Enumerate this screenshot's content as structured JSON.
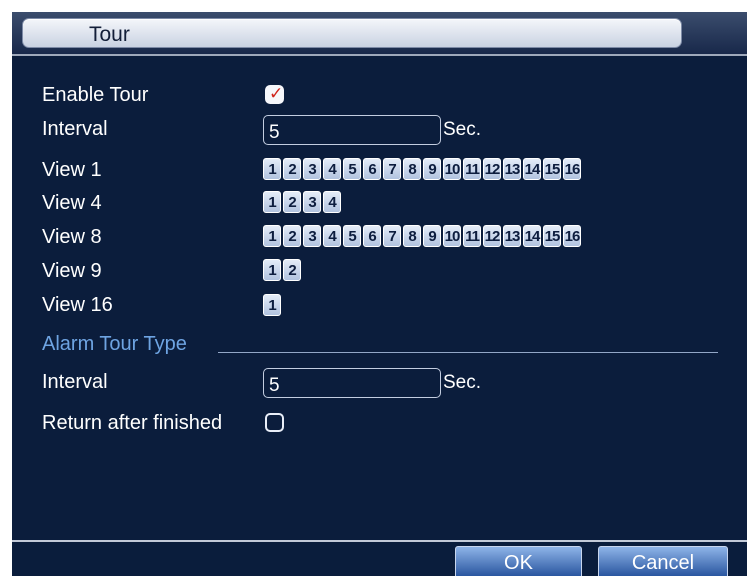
{
  "window": {
    "title": "Tour"
  },
  "tour": {
    "enable_label": "Enable Tour",
    "enable_checked": true,
    "interval_label": "Interval",
    "interval_value": "5",
    "interval_unit": "Sec.",
    "views": [
      {
        "label": "View 1",
        "channels": [
          "1",
          "2",
          "3",
          "4",
          "5",
          "6",
          "7",
          "8",
          "9",
          "10",
          "11",
          "12",
          "13",
          "14",
          "15",
          "16"
        ]
      },
      {
        "label": "View 4",
        "channels": [
          "1",
          "2",
          "3",
          "4"
        ]
      },
      {
        "label": "View 8",
        "channels": [
          "1",
          "2",
          "3",
          "4",
          "5",
          "6",
          "7",
          "8",
          "9",
          "10",
          "11",
          "12",
          "13",
          "14",
          "15",
          "16"
        ]
      },
      {
        "label": "View 9",
        "channels": [
          "1",
          "2"
        ]
      },
      {
        "label": "View 16",
        "channels": [
          "1"
        ]
      }
    ]
  },
  "alarm": {
    "section_label": "Alarm Tour Type",
    "interval_label": "Interval",
    "interval_value": "5",
    "interval_unit": "Sec.",
    "return_label": "Return after finished",
    "return_checked": false
  },
  "buttons": {
    "ok_label": "OK",
    "cancel_label": "Cancel"
  },
  "colors": {
    "panel_bg": "#0b1d3c",
    "section_text": "#6ea4e2",
    "check_mark": "#d0241c"
  }
}
